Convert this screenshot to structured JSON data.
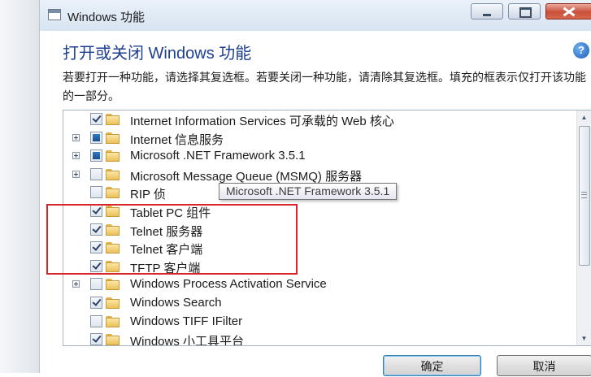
{
  "window": {
    "title": "Windows 功能",
    "heading": "打开或关闭 Windows 功能",
    "description": "若要打开一种功能，请选择其复选框。若要关闭一种功能，请清除其复选框。填充的框表示仅打开该功能的一部分。",
    "help_icon": "help-icon",
    "controls": [
      "minimize-icon",
      "maximize-icon",
      "close-icon"
    ]
  },
  "features": [
    {
      "label": "Internet Information Services 可承载的 Web 核心",
      "state": "checked",
      "expander": false
    },
    {
      "label": "Internet 信息服务",
      "state": "partial",
      "expander": true
    },
    {
      "label": "Microsoft .NET Framework 3.5.1",
      "state": "partial",
      "expander": true
    },
    {
      "label": "Microsoft Message Queue (MSMQ) 服务器",
      "state": "unchecked",
      "expander": true
    },
    {
      "label": "RIP 侦",
      "state": "unchecked",
      "expander": false
    },
    {
      "label": "Tablet PC 组件",
      "state": "checked",
      "expander": false
    },
    {
      "label": "Telnet 服务器",
      "state": "checked",
      "expander": false
    },
    {
      "label": "Telnet 客户端",
      "state": "checked",
      "expander": false
    },
    {
      "label": "TFTP 客户端",
      "state": "checked",
      "expander": false
    },
    {
      "label": "Windows Process Activation Service",
      "state": "unchecked",
      "expander": true
    },
    {
      "label": "Windows Search",
      "state": "checked",
      "expander": false
    },
    {
      "label": "Windows TIFF IFilter",
      "state": "unchecked",
      "expander": false
    },
    {
      "label": "Windows 小工具平台",
      "state": "checked",
      "expander": false
    }
  ],
  "tooltip": "Microsoft .NET Framework 3.5.1",
  "buttons": {
    "ok": "确定",
    "cancel": "取消"
  },
  "colors": {
    "heading": "#1e3f8f",
    "highlight_border": "#d9262c",
    "close_button": "#c9503a"
  }
}
